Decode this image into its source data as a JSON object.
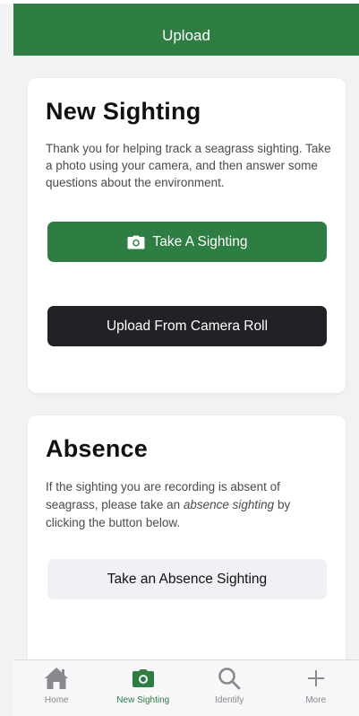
{
  "header": {
    "title": "Upload"
  },
  "new_sighting": {
    "title": "New Sighting",
    "description": "Thank you for helping track a seagrass sighting. Take a photo using your camera, and then answer some questions about the environment.",
    "take_button": "Take A Sighting",
    "upload_button": "Upload From Camera Roll"
  },
  "absence": {
    "title": "Absence",
    "text_before": "If the sighting you are recording is absent of seagrass, please take an ",
    "text_em": "absence sighting",
    "text_after": " by clicking the button below.",
    "button": "Take an Absence Sighting"
  },
  "tabbar": {
    "items": [
      {
        "label": "Home",
        "icon": "home-icon",
        "active": false
      },
      {
        "label": "New Sighting",
        "icon": "camera-icon",
        "active": true
      },
      {
        "label": "Identify",
        "icon": "search-icon",
        "active": false
      },
      {
        "label": "More",
        "icon": "plus-icon",
        "active": false
      }
    ]
  },
  "colors": {
    "brand_green": "#2e7d43",
    "dark_button": "#222226",
    "light_button": "#f1f1f5",
    "background": "#f2f2f4",
    "inactive_tab": "#8a8a8e"
  }
}
